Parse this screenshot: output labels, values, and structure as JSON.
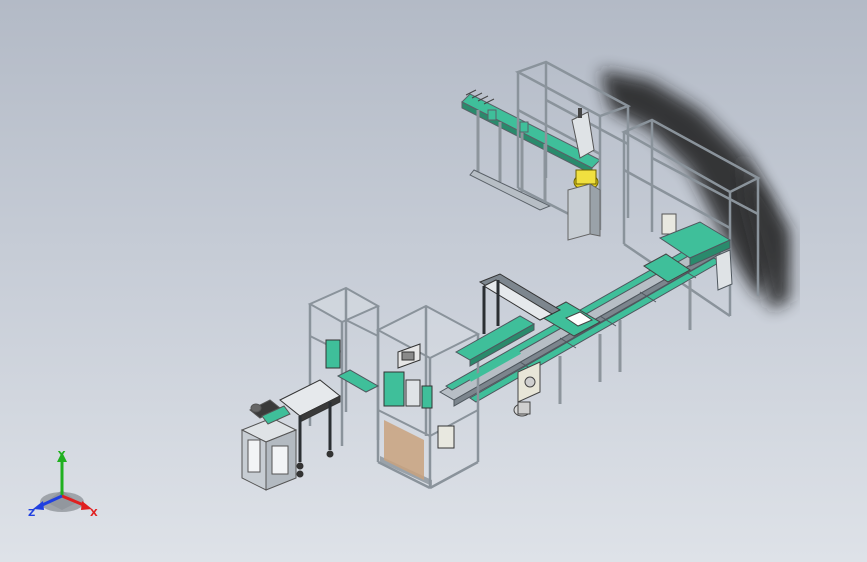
{
  "viewport": {
    "background_top": "#b3bac6",
    "background_bottom": "#dee2e8"
  },
  "model": {
    "frame_color": "#9aa3ab",
    "conveyor_color": "#3fbf9a",
    "guard_color": "#c7d0d8",
    "shadow_color": "#2a2a2a",
    "pallet_color": "#c9a27e",
    "accent_yellow": "#e8d21c"
  },
  "triad": {
    "x_label": "X",
    "y_label": "Y",
    "z_label": "Z",
    "x_color": "#e02020",
    "y_color": "#20b020",
    "z_color": "#2040e0"
  }
}
